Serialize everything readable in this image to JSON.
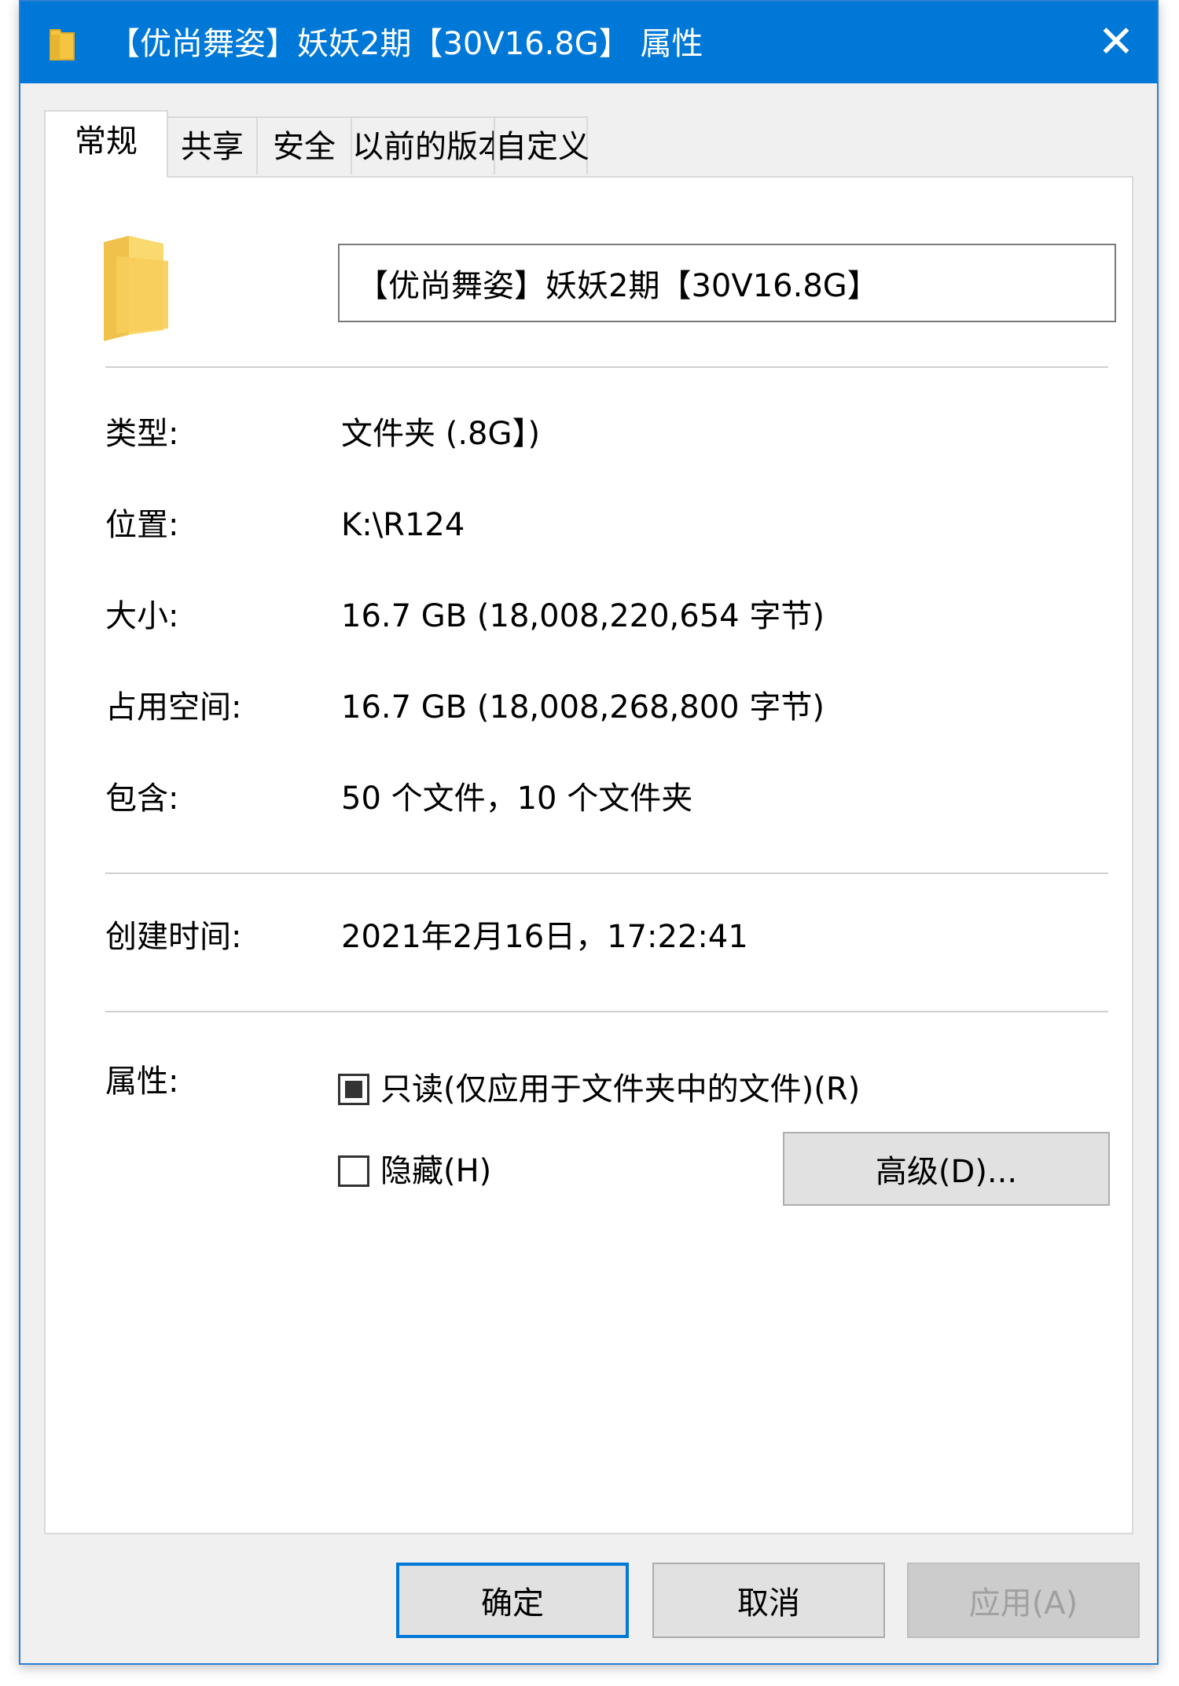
{
  "window": {
    "title": "【优尚舞姿】妖妖2期【30V16.8G】 属性",
    "close_label": "✕"
  },
  "tabs": [
    {
      "label": "常规",
      "active": true
    },
    {
      "label": "共享",
      "active": false
    },
    {
      "label": "安全",
      "active": false
    },
    {
      "label": "以前的版本",
      "active": false
    },
    {
      "label": "自定义",
      "active": false
    }
  ],
  "general": {
    "folder_name": "【优尚舞姿】妖妖2期【30V16.8G】",
    "type": {
      "label": "类型:",
      "value": "文件夹 (.8G】)"
    },
    "location": {
      "label": "位置:",
      "value": "K:\\R124"
    },
    "size": {
      "label": "大小:",
      "value": "16.7 GB (18,008,220,654 字节)"
    },
    "size_on_disk": {
      "label": "占用空间:",
      "value": "16.7 GB (18,008,268,800 字节)"
    },
    "contains": {
      "label": "包含:",
      "value": "50 个文件，10 个文件夹"
    },
    "created": {
      "label": "创建时间:",
      "value": "2021年2月16日，17:22:41"
    },
    "attributes": {
      "label": "属性:",
      "readonly": {
        "label": "只读(仅应用于文件夹中的文件)(R)",
        "state": "indeterminate"
      },
      "hidden": {
        "label": "隐藏(H)",
        "state": "unchecked"
      },
      "advanced_label": "高级(D)..."
    }
  },
  "buttons": {
    "ok": "确定",
    "cancel": "取消",
    "apply": "应用(A)"
  },
  "colors": {
    "titlebar": "#0078d7",
    "folder": "#f5c542",
    "default_button_border": "#0078d7"
  },
  "icons": {
    "title_icon": "folder-icon",
    "main_icon": "folder-icon",
    "close": "close-icon"
  }
}
